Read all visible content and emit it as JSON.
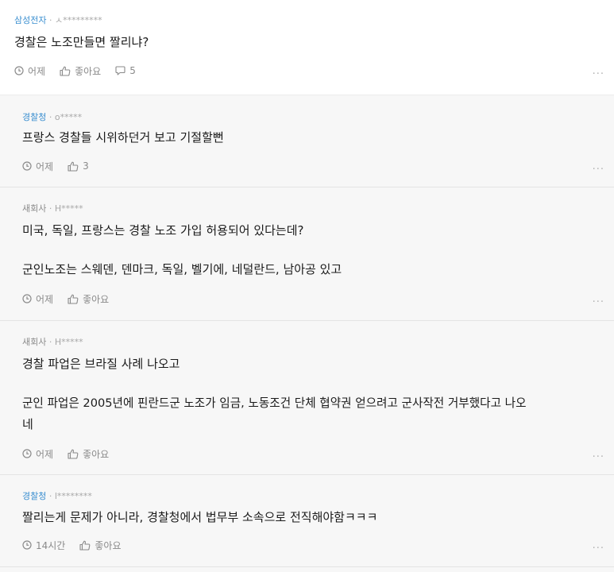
{
  "post": {
    "company": "삼성전자",
    "separator": "·",
    "user": "ㅅ*********",
    "text": "경찰은 노조만들면 짤리냐?",
    "time": "어제",
    "like_label": "좋아요",
    "comment_count": "5",
    "more": "..."
  },
  "replies": [
    {
      "company": "경찰청",
      "separator": "·",
      "user": "o*****",
      "lines": [
        "프랑스 경찰들 시위하던거 보고 기절할뻔"
      ],
      "time": "어제",
      "likes": "3",
      "more": "..."
    },
    {
      "company": "새회사",
      "separator": "·",
      "user": "H*****",
      "lines": [
        "미국, 독일, 프랑스는 경찰 노조 가입 허용되어 있다는데?",
        "군인노조는 스웨덴, 덴마크, 독일, 벨기에, 네덜란드, 남아공 있고"
      ],
      "time": "어제",
      "likes": "좋아요",
      "more": "..."
    },
    {
      "company": "새회사",
      "separator": "·",
      "user": "H*****",
      "lines": [
        "경찰 파업은 브라질 사례 나오고",
        "군인 파업은 2005년에 핀란드군 노조가 임금, 노동조건 단체 협약권 얻으려고 군사작전 거부했다고 나오",
        "네"
      ],
      "time": "어제",
      "likes": "좋아요",
      "more": "..."
    },
    {
      "company": "경찰청",
      "separator": "·",
      "user": "l********",
      "lines": [
        "짤리는게 문제가 아니라, 경찰청에서 법무부 소속으로 전직해야함ㅋㅋㅋ"
      ],
      "time": "14시간",
      "likes": "좋아요",
      "more": "..."
    }
  ],
  "colors": {
    "company_blue": "#3b8fd0",
    "company_gray": "#8a8a8a",
    "reply_bg": "#f7f7f7"
  },
  "icons": {
    "time": "clock-icon",
    "like": "thumbs-up-icon",
    "comment": "comment-icon"
  }
}
